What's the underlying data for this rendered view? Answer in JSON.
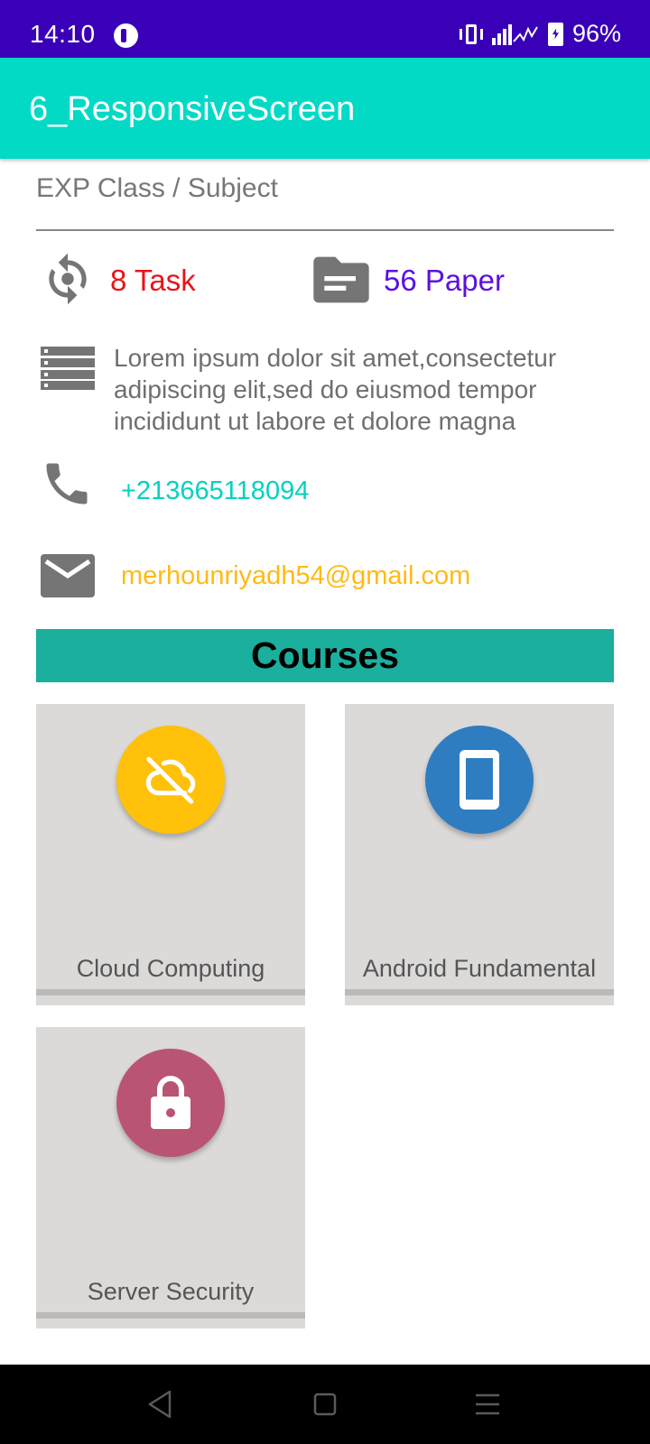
{
  "status_bar": {
    "time": "14:10",
    "battery": "96%",
    "icons": [
      "app-icon",
      "vibrate-icon",
      "signal-icon",
      "battery-charging-icon"
    ]
  },
  "app_bar": {
    "title": "6_ResponsiveScreen"
  },
  "profile": {
    "subject_text": "EXP Class / Subject",
    "task_count": "8 Task",
    "paper_count": "56 Paper",
    "description": "Lorem ipsum dolor sit amet,consectetur adipiscing elit,sed do eiusmod tempor incididunt ut labore et dolore magna",
    "phone": "+213665118094",
    "email": "merhounriyadh54@gmail.com",
    "icons": [
      "sync-icon",
      "folder-icon",
      "list-icon",
      "phone-icon",
      "email-icon"
    ]
  },
  "courses": {
    "title": "Courses",
    "items": [
      {
        "label": "Cloud Computing",
        "icon": "cloud-off-icon",
        "color": "#ffc10a"
      },
      {
        "label": "Android Fundamental",
        "icon": "smartphone-icon",
        "color": "#2f7dc1"
      },
      {
        "label": "Server Security",
        "icon": "lock-icon",
        "color": "#b95573"
      }
    ]
  },
  "colors": {
    "status_bar": "#3a00b8",
    "app_bar": "#03dac6",
    "courses_header": "#1baf9d",
    "task": "#e8141a",
    "paper": "#5b11e0",
    "phone": "#03d1bf",
    "email": "#ffba14"
  },
  "nav_bar": {
    "buttons": [
      "back",
      "home",
      "recents"
    ]
  }
}
